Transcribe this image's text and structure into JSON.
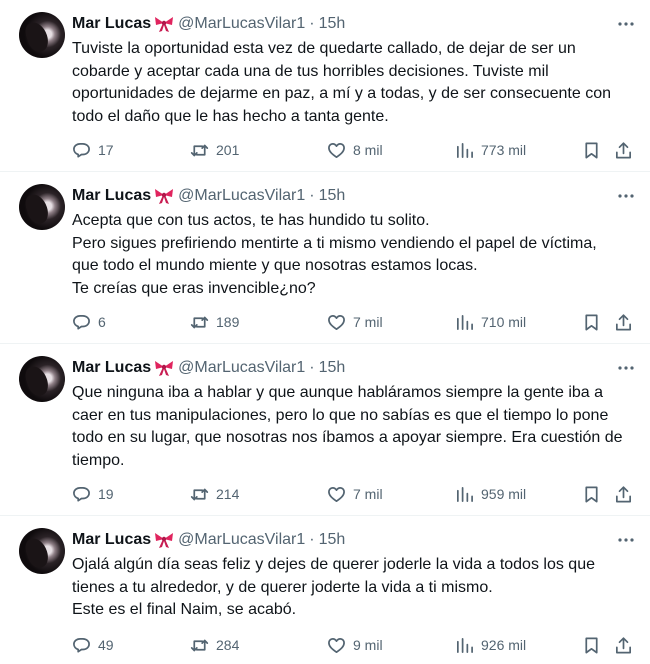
{
  "tweets": [
    {
      "author": {
        "name": "Mar Lucas",
        "handle": "@MarLucasVilar1",
        "emoji": "ribbon"
      },
      "separator": "·",
      "time": "15h",
      "text": "Tuviste la oportunidad esta vez de quedarte callado, de dejar de ser un\ncobarde y aceptar cada una de tus horribles decisiones. Tuviste mil\noportunidades de dejarme en paz, a mí y a todas, y de ser consecuente con\ntodo el daño que le has hecho a tanta gente.",
      "stats": {
        "replies": "17",
        "retweets": "201",
        "likes": "8 mil",
        "views": "773 mil"
      }
    },
    {
      "author": {
        "name": "Mar Lucas",
        "handle": "@MarLucasVilar1",
        "emoji": "ribbon"
      },
      "separator": "·",
      "time": "15h",
      "text": "Acepta que con tus actos, te has hundido tu solito.\n Pero sigues prefiriendo mentirte a ti mismo vendiendo el papel de víctima,\nque todo el mundo miente y que nosotras estamos locas.\n Te creías que eras invencible¿no?",
      "stats": {
        "replies": "6",
        "retweets": "189",
        "likes": "7 mil",
        "views": "710 mil"
      }
    },
    {
      "author": {
        "name": "Mar Lucas",
        "handle": "@MarLucasVilar1",
        "emoji": "ribbon"
      },
      "separator": "·",
      "time": "15h",
      "text": "Que ninguna iba a hablar y que aunque habláramos siempre la gente iba a\ncaer en tus manipulaciones, pero lo que no sabías es que el tiempo lo pone\ntodo en su lugar, que nosotras nos íbamos a apoyar siempre. Era cuestión de\ntiempo.",
      "stats": {
        "replies": "19",
        "retweets": "214",
        "likes": "7 mil",
        "views": "959 mil"
      }
    },
    {
      "author": {
        "name": "Mar Lucas",
        "handle": "@MarLucasVilar1",
        "emoji": "ribbon"
      },
      "separator": "·",
      "time": "15h",
      "text": "Ojalá algún día seas feliz y dejes de querer joderle la vida a todos los que\ntienes a tu alrededor, y de querer joderte la vida a ti mismo.\n Este es el final Naim, se acabó.",
      "stats": {
        "replies": "49",
        "retweets": "284",
        "likes": "9 mil",
        "views": "926 mil"
      }
    }
  ],
  "icons": {
    "more": "more-horizontal-icon",
    "reply": "reply-icon",
    "retweet": "retweet-icon",
    "like": "heart-icon",
    "views": "views-icon",
    "bookmark": "bookmark-icon",
    "share": "share-icon"
  },
  "colors": {
    "text": "#0f1419",
    "secondary": "#536471",
    "ribbon": "#e0245e",
    "divider": "#eff3f4"
  }
}
